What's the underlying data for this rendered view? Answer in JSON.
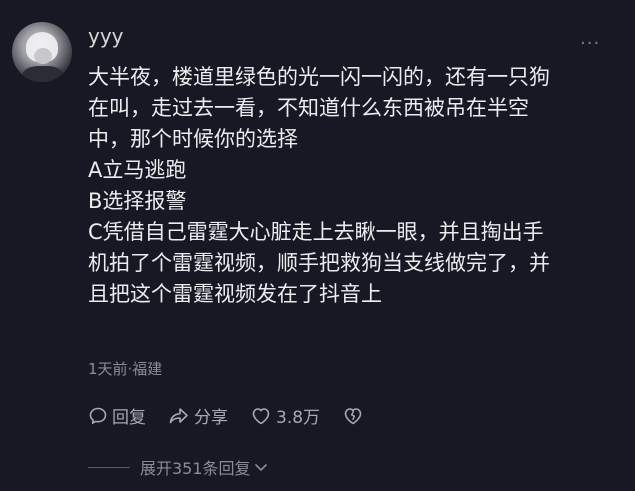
{
  "comment": {
    "username": "yyy",
    "lines": [
      "大半夜，楼道里绿色的光一闪一闪的，还有一只狗",
      "在叫，走过去一看，不知道什么东西被吊在半空",
      "中，那个时候你的选择",
      "A立马逃跑",
      "B选择报警",
      "C凭借自己雷霆大心脏走上去瞅一眼，并且掏出手",
      "机拍了个雷霆视频，顺手把救狗当支线做完了，并",
      "且把这个雷霆视频发在了抖音上"
    ],
    "meta": "1天前·福建",
    "actions": {
      "reply": "回复",
      "share": "分享",
      "likes": "3.8万"
    },
    "expand": "展开351条回复"
  },
  "icons": {
    "more": "more-dots-icon",
    "reply": "speech-bubble-icon",
    "share": "share-arrow-icon",
    "like": "heart-icon",
    "dislike": "broken-heart-icon",
    "expand": "chevron-down-icon"
  },
  "colors": {
    "background": "#161823",
    "text": "#ececef",
    "muted": "#8b8c94"
  }
}
